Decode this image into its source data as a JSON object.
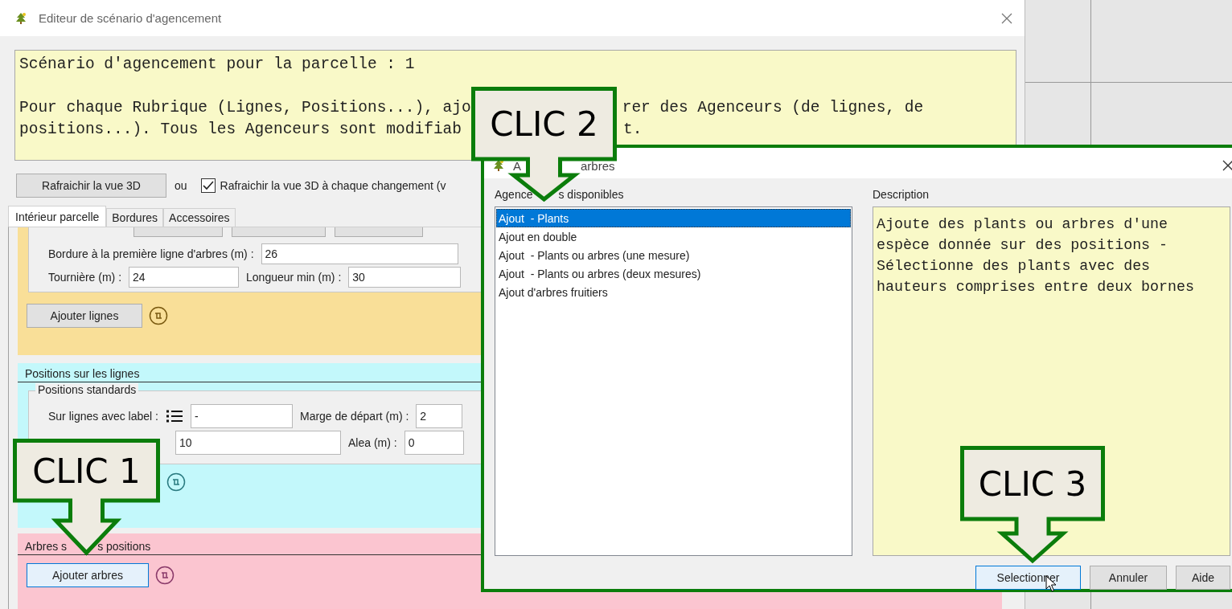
{
  "window": {
    "title": "Editeur de scénario d'agencement"
  },
  "info": {
    "heading": "Scénario d'agencement pour la parcelle : 1",
    "lines": [
      {
        "before": "Pour chaque Rubrique (Lignes, Positions...), ajo",
        "after": "rer des Agenceurs (de lignes, de"
      },
      {
        "before": "positions...). Tous les Agenceurs sont modifiab",
        "after": "t."
      }
    ]
  },
  "toolbar": {
    "refresh_button": "Rafraichir la vue 3D",
    "separator": "ou",
    "auto_refresh": {
      "label": "Rafraichir la vue 3D à chaque changement (v",
      "checked": true
    }
  },
  "tabs": [
    {
      "label": "Intérieur parcelle",
      "selected": true
    },
    {
      "label": "Bordures",
      "selected": false
    },
    {
      "label": "Accessoires",
      "selected": false
    }
  ],
  "lines_section": {
    "rows": [
      [
        {
          "label": "Bordure à la première ligne d'arbres (m) :",
          "value": "26"
        }
      ],
      [
        {
          "label": "Tournière (m) :",
          "value": "24"
        },
        {
          "label": "Longueur min (m) :",
          "value": "30"
        }
      ]
    ],
    "button": {
      "label": "Ajouter lignes",
      "focused": false
    }
  },
  "positions_section": {
    "title": "Positions sur les lignes",
    "group": "Positions standards",
    "rows": [
      [
        {
          "label": "Sur lignes avec label :",
          "kind": "list",
          "value": "-"
        },
        {
          "label": "Marge de départ (m) :",
          "kind": "plain",
          "value": "2"
        }
      ],
      [
        {
          "kind": "hidden",
          "value": "10"
        },
        {
          "label": "Alea (m) :",
          "kind": "plain",
          "value": "0"
        }
      ]
    ]
  },
  "trees_section": {
    "title_parts": [
      "Arbres s",
      "s positions"
    ],
    "button": {
      "label": "Ajouter arbres",
      "focused": true
    }
  },
  "dialog": {
    "title_parts": [
      "A",
      "arbres"
    ],
    "list_label_parts": [
      "Agence",
      "s disponibles"
    ],
    "items": [
      {
        "label": "Ajout  - Plants",
        "selected": true
      },
      {
        "label": "Ajout en double",
        "selected": false
      },
      {
        "label": "Ajout  - Plants ou arbres (une mesure)",
        "selected": false
      },
      {
        "label": "Ajout  - Plants ou arbres (deux mesures)",
        "selected": false
      },
      {
        "label": "Ajout d'arbres fruitiers",
        "selected": false
      }
    ],
    "description_label": "Description",
    "description_lines": [
      "Ajoute des plants ou arbres d'une",
      "espèce donnée sur des positions -",
      "Sélectionne des plants avec des",
      "hauteurs comprises entre deux bornes"
    ],
    "buttons": [
      {
        "label": "Selectionner",
        "focused": true
      },
      {
        "label": "Annuler",
        "focused": false
      },
      {
        "label": "Aide",
        "focused": false
      }
    ]
  },
  "callouts": [
    {
      "label": "CLIC 1"
    },
    {
      "label": "CLIC 2"
    },
    {
      "label": "CLIC 3"
    }
  ]
}
